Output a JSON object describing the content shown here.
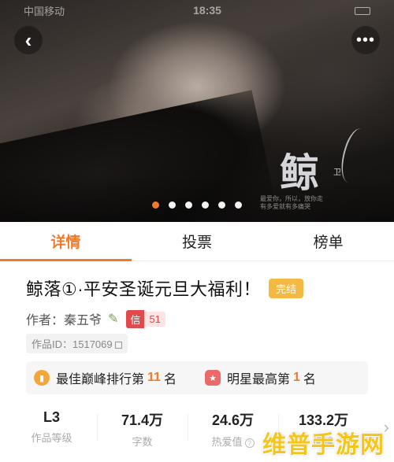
{
  "status_bar": {
    "carrier": "中国移动",
    "time": "18:35",
    "battery": ""
  },
  "banner": {
    "logo_char": "鲸",
    "logo_side": "卫 ",
    "credits": "最爱你，所以，放你走\n有多爱就有多痛哭",
    "dots": 6,
    "active_dot": 0
  },
  "tabs": [
    {
      "label": "详情",
      "active": true
    },
    {
      "label": "投票",
      "active": false
    },
    {
      "label": "榜单",
      "active": false
    }
  ],
  "work": {
    "title": "鲸落①·平安圣诞元旦大福利！",
    "status_badge": "完结",
    "author_label": "作者：秦五爷",
    "credit_badge": "信",
    "credit_value": "51",
    "work_id": "作品ID：1517069"
  },
  "ranks": [
    {
      "prefix": "最佳巅峰排行第",
      "num": "11",
      "suffix": "名",
      "icon": "peak-chart-icon"
    },
    {
      "prefix": "明星最高第",
      "num": "1",
      "suffix": "名",
      "icon": "star-icon"
    }
  ],
  "stats": [
    {
      "value": "L3",
      "label": "作品等级"
    },
    {
      "value": "71.4万",
      "label": "字数"
    },
    {
      "value": "24.6万",
      "label": "热爱值"
    },
    {
      "value": "133.2万",
      "label": "阅读"
    }
  ],
  "watermark": "维普手游网",
  "colors": {
    "accent": "#f07a2b",
    "badge_done": "#f3b943",
    "credit_red": "#e04a4a"
  }
}
